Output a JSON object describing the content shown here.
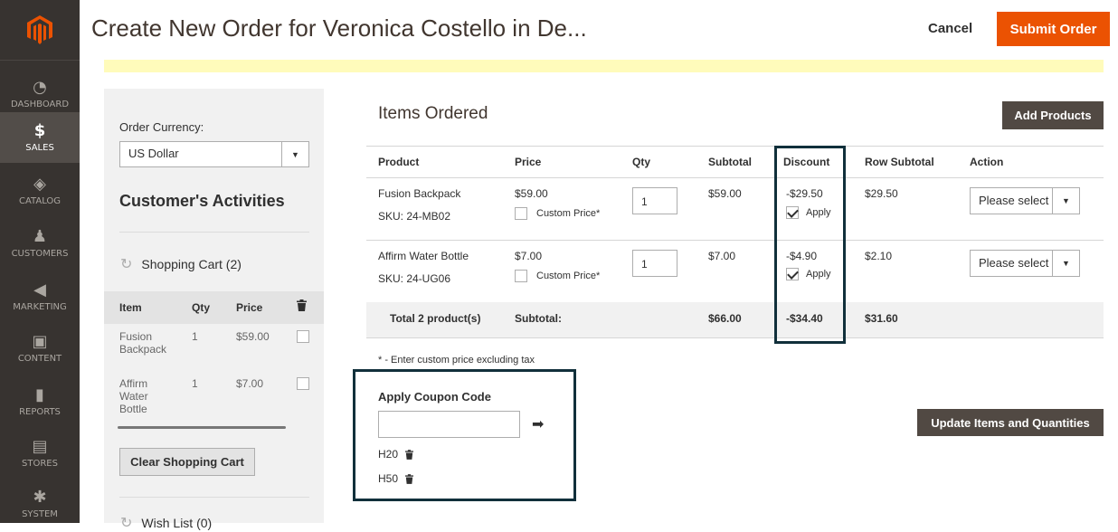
{
  "nav": {
    "items": [
      {
        "label": "DASHBOARD",
        "icon": "dashboard-icon",
        "glyph": "◔"
      },
      {
        "label": "SALES",
        "icon": "dollar-icon",
        "glyph": "$"
      },
      {
        "label": "CATALOG",
        "icon": "cube-icon",
        "glyph": "◈"
      },
      {
        "label": "CUSTOMERS",
        "icon": "person-icon",
        "glyph": "♟"
      },
      {
        "label": "MARKETING",
        "icon": "megaphone-icon",
        "glyph": "◀"
      },
      {
        "label": "CONTENT",
        "icon": "layout-icon",
        "glyph": "▣"
      },
      {
        "label": "REPORTS",
        "icon": "bar-chart-icon",
        "glyph": "▮"
      },
      {
        "label": "STORES",
        "icon": "store-icon",
        "glyph": "▤"
      },
      {
        "label": "SYSTEM",
        "icon": "gear-icon",
        "glyph": "✱"
      }
    ],
    "active": "SALES",
    "brand_color": "#eb5202"
  },
  "header": {
    "title": "Create New Order for Veronica Costello in De...",
    "cancel_label": "Cancel",
    "submit_label": "Submit Order"
  },
  "sidebar": {
    "currency_label": "Order Currency:",
    "currency_value": "US Dollar",
    "activities_title": "Customer's Activities",
    "cart_title": "Shopping Cart (2)",
    "cart_columns": [
      "Item",
      "Qty",
      "Price"
    ],
    "cart_items": [
      {
        "name": "Fusion Backpack",
        "qty": "1",
        "price": "$59.00"
      },
      {
        "name": "Affirm Water Bottle",
        "qty": "1",
        "price": "$7.00"
      }
    ],
    "clear_label": "Clear Shopping Cart",
    "wishlist_title": "Wish List (0)"
  },
  "items": {
    "title": "Items Ordered",
    "add_products_label": "Add Products",
    "columns": [
      "Product",
      "Price",
      "Qty",
      "Subtotal",
      "Discount",
      "Row Subtotal",
      "Action"
    ],
    "rows": [
      {
        "product": "Fusion Backpack",
        "sku": "SKU: 24-MB02",
        "price": "$59.00",
        "custom_price_label": "Custom Price*",
        "qty": "1",
        "subtotal": "$59.00",
        "discount": "-$29.50",
        "apply_label": "Apply",
        "row_subtotal": "$29.50",
        "action": "Please select"
      },
      {
        "product": "Affirm Water Bottle",
        "sku": "SKU: 24-UG06",
        "price": "$7.00",
        "custom_price_label": "Custom Price*",
        "qty": "1",
        "subtotal": "$7.00",
        "discount": "-$4.90",
        "apply_label": "Apply",
        "row_subtotal": "$2.10",
        "action": "Please select"
      }
    ],
    "total": {
      "label": "Total 2 product(s)",
      "subtotal_label": "Subtotal:",
      "subtotal": "$66.00",
      "discount": "-$34.40",
      "row_subtotal": "$31.60"
    },
    "note": "* - Enter custom price excluding tax",
    "update_label": "Update Items and Quantities"
  },
  "coupon": {
    "title": "Apply Coupon Code",
    "value": "",
    "codes": [
      "H20",
      "H50"
    ]
  },
  "colors": {
    "highlight_border": "#11303b",
    "notice": "#fffbbb",
    "dark_button": "#514943"
  }
}
